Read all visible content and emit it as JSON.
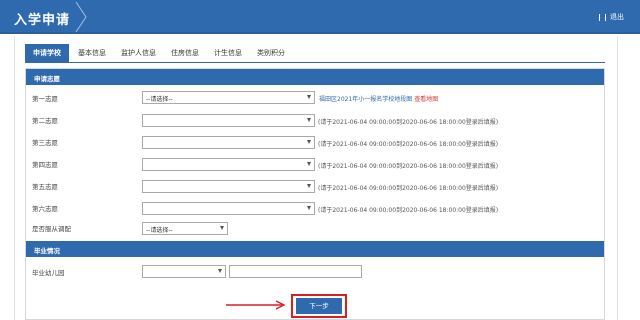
{
  "header": {
    "title": "入学申请",
    "logout": "退出"
  },
  "tabs": [
    "申请学校",
    "基本信息",
    "监护人信息",
    "住房信息",
    "计生信息",
    "类别积分"
  ],
  "section1": {
    "title": "申请志愿",
    "rows": [
      {
        "label": "第一志愿",
        "value": "--请选择--",
        "note": ""
      },
      {
        "label": "第二志愿",
        "value": "",
        "note": "(请于2021-06-04 09:00:00到2020-06-06 18:00:00登录后填报)"
      },
      {
        "label": "第三志愿",
        "value": "",
        "note": "(请于2021-06-04 09:00:00到2020-06-06 18:00:00登录后填报)"
      },
      {
        "label": "第四志愿",
        "value": "",
        "note": "(请于2021-06-04 09:00:00到2020-06-06 18:00:00登录后填报)"
      },
      {
        "label": "第五志愿",
        "value": "",
        "note": "(请于2021-06-04 09:00:00到2020-06-06 18:00:00登录后填报)"
      },
      {
        "label": "第六志愿",
        "value": "",
        "note": "(请于2021-06-04 09:00:00到2020-06-06 18:00:00登录后填报)"
      }
    ],
    "first_link_blue": "福田区2021年小一报名学校地段图",
    "first_link_red": "查看地图",
    "obey": {
      "label": "是否服从调配",
      "value": "--请选择--"
    }
  },
  "section2": {
    "title": "毕业情况",
    "kindergarten": {
      "label": "毕业幼儿园",
      "value": ""
    }
  },
  "next_button": "下一步",
  "colors": {
    "primary": "#2e6aad",
    "highlight": "#d81f26"
  }
}
